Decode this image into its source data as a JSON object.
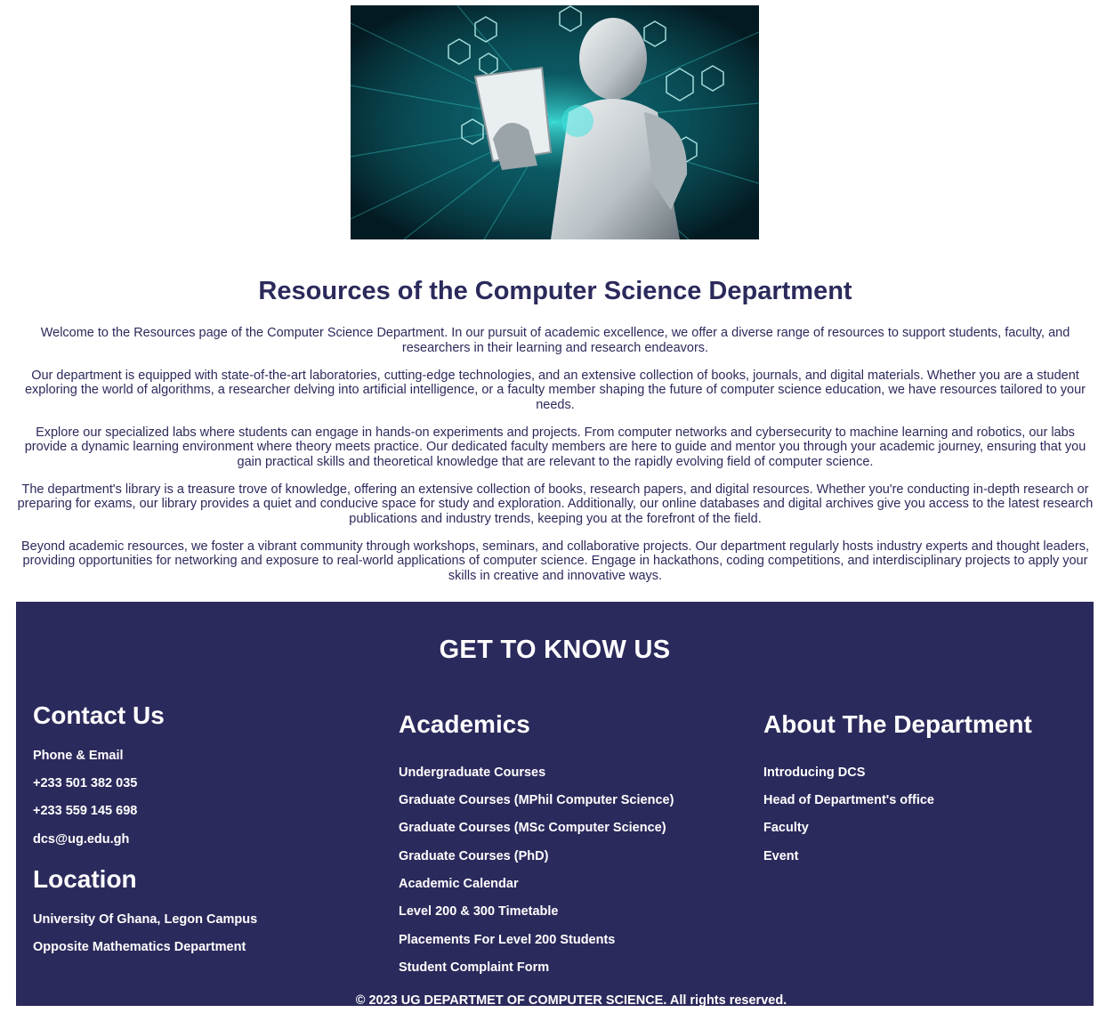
{
  "page": {
    "title": "Resources of the Computer Science Department",
    "paragraphs": [
      "Welcome to the Resources page of the Computer Science Department. In our pursuit of academic excellence, we offer a diverse range of resources to support students, faculty, and researchers in their learning and research endeavors.",
      "Our department is equipped with state-of-the-art laboratories, cutting-edge technologies, and an extensive collection of books, journals, and digital materials. Whether you are a student exploring the world of algorithms, a researcher delving into artificial intelligence, or a faculty member shaping the future of computer science education, we have resources tailored to your needs.",
      "Explore our specialized labs where students can engage in hands-on experiments and projects. From computer networks and cybersecurity to machine learning and robotics, our labs provide a dynamic learning environment where theory meets practice. Our dedicated faculty members are here to guide and mentor you through your academic journey, ensuring that you gain practical skills and theoretical knowledge that are relevant to the rapidly evolving field of computer science.",
      "The department's library is a treasure trove of knowledge, offering an extensive collection of books, research papers, and digital resources. Whether you're conducting in-depth research or preparing for exams, our library provides a quiet and conducive space for study and exploration. Additionally, our online databases and digital archives give you access to the latest research publications and industry trends, keeping you at the forefront of the field.",
      "Beyond academic resources, we foster a vibrant community through workshops, seminars, and collaborative projects. Our department regularly hosts industry experts and thought leaders, providing opportunities for networking and exposure to real-world applications of computer science. Engage in hackathons, coding competitions, and interdisciplinary projects to apply your skills in creative and innovative ways."
    ]
  },
  "footer": {
    "heading": "GET TO KNOW US",
    "contact": {
      "title": "Contact Us",
      "items": [
        "Phone & Email",
        "+233 501 382 035",
        "+233 559 145 698",
        "dcs@ug.edu.gh"
      ]
    },
    "location": {
      "title": "Location",
      "items": [
        "University Of Ghana, Legon Campus",
        "Opposite Mathematics Department"
      ]
    },
    "academics": {
      "title": "Academics",
      "items": [
        "Undergraduate Courses",
        "Graduate Courses (MPhil Computer Science)",
        "Graduate Courses (MSc Computer Science)",
        "Graduate Courses (PhD)",
        "Academic Calendar",
        "Level 200 & 300 Timetable",
        "Placements For Level 200 Students",
        "Student Complaint Form"
      ]
    },
    "about": {
      "title": "About The Department",
      "items": [
        "Introducing DCS",
        "Head of Department's office",
        "Faculty",
        "Event"
      ]
    },
    "copyright": "© 2023 UG DEPARTMET OF COMPUTER SCIENCE. All rights reserved."
  },
  "colors": {
    "brand_navy": "#2b2a5c",
    "footer_text": "#ffffff",
    "hero_accent": "#3fe6e0"
  },
  "icons": [
    "robot-illustration"
  ]
}
